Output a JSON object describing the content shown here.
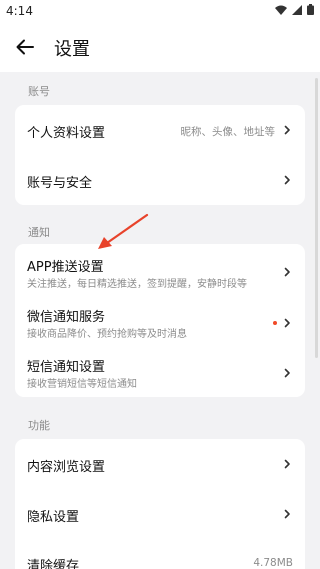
{
  "status_bar": {
    "time": "4:14"
  },
  "header": {
    "title": "设置"
  },
  "sections": {
    "account": {
      "label": "账号",
      "items": [
        {
          "title": "个人资料设置",
          "value": "昵称、头像、地址等"
        },
        {
          "title": "账号与安全"
        }
      ]
    },
    "notification": {
      "label": "通知",
      "items": [
        {
          "title": "APP推送设置",
          "subtitle": "关注推送，每日精选推送，签到提醒，安静时段等"
        },
        {
          "title": "微信通知服务",
          "subtitle": "接收商品降价、预约抢购等及时消息",
          "has_dot": true
        },
        {
          "title": "短信通知设置",
          "subtitle": "接收营销短信等短信通知"
        }
      ]
    },
    "features": {
      "label": "功能",
      "items": [
        {
          "title": "内容浏览设置"
        },
        {
          "title": "隐私设置"
        },
        {
          "title": "清除缓存",
          "value": "4.78MB"
        }
      ]
    }
  },
  "colors": {
    "accent_red": "#f04a28",
    "background": "#f2f2f4",
    "card": "#ffffff"
  }
}
